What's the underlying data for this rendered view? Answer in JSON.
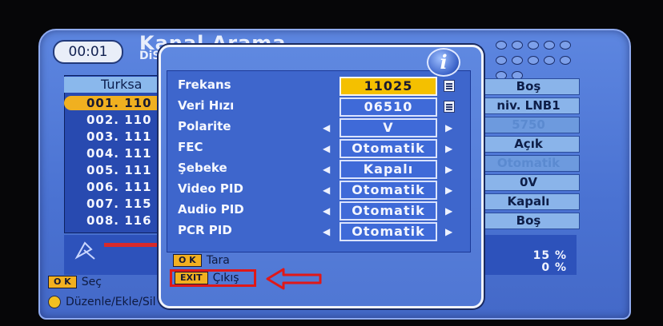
{
  "header": {
    "time": "00:01",
    "title": "Kanal Arama",
    "subtitle": "DiS"
  },
  "channel_list": {
    "header": "Turksa",
    "items": [
      {
        "label": "001. 110",
        "selected": true
      },
      {
        "label": "002. 110",
        "selected": false
      },
      {
        "label": "003. 111",
        "selected": false
      },
      {
        "label": "004. 111",
        "selected": false
      },
      {
        "label": "005. 111",
        "selected": false
      },
      {
        "label": "006. 111",
        "selected": false
      },
      {
        "label": "007. 115",
        "selected": false
      },
      {
        "label": "008. 116",
        "selected": false
      }
    ]
  },
  "right_panel": {
    "items": [
      "Boş",
      "niv. LNB1",
      "5750",
      "Açık",
      "Otomatik",
      "0V",
      "Kapalı",
      "Boş"
    ]
  },
  "signal": {
    "strength": "15 %",
    "quality": "0 %"
  },
  "bottom_legend": {
    "ok_key": "O K",
    "ok_label": "Seç",
    "edit_label": "Düzenle/Ekle/Sil"
  },
  "dialog": {
    "info_icon": "i",
    "rows": [
      {
        "label": "Frekans",
        "value": "11025",
        "selected": true,
        "control": "keyboard"
      },
      {
        "label": "Veri Hızı",
        "value": "06510",
        "selected": false,
        "control": "keyboard"
      },
      {
        "label": "Polarite",
        "value": "V",
        "selected": false,
        "control": "arrows"
      },
      {
        "label": "FEC",
        "value": "Otomatik",
        "selected": false,
        "control": "arrows"
      },
      {
        "label": "Şebeke",
        "value": "Kapalı",
        "selected": false,
        "control": "arrows"
      },
      {
        "label": "Video PID",
        "value": "Otomatik",
        "selected": false,
        "control": "arrows"
      },
      {
        "label": "Audio PID",
        "value": "Otomatik",
        "selected": false,
        "control": "arrows"
      },
      {
        "label": "PCR PID",
        "value": "Otomatik",
        "selected": false,
        "control": "arrows"
      }
    ],
    "ok_key": "O K",
    "ok_label": "Tara",
    "exit_key": "EXIT",
    "exit_label": "Çıkış"
  },
  "colors": {
    "selection_yellow": "#f4c000",
    "annotation_red": "#e01818",
    "panel_blue": "#3e66cc"
  }
}
